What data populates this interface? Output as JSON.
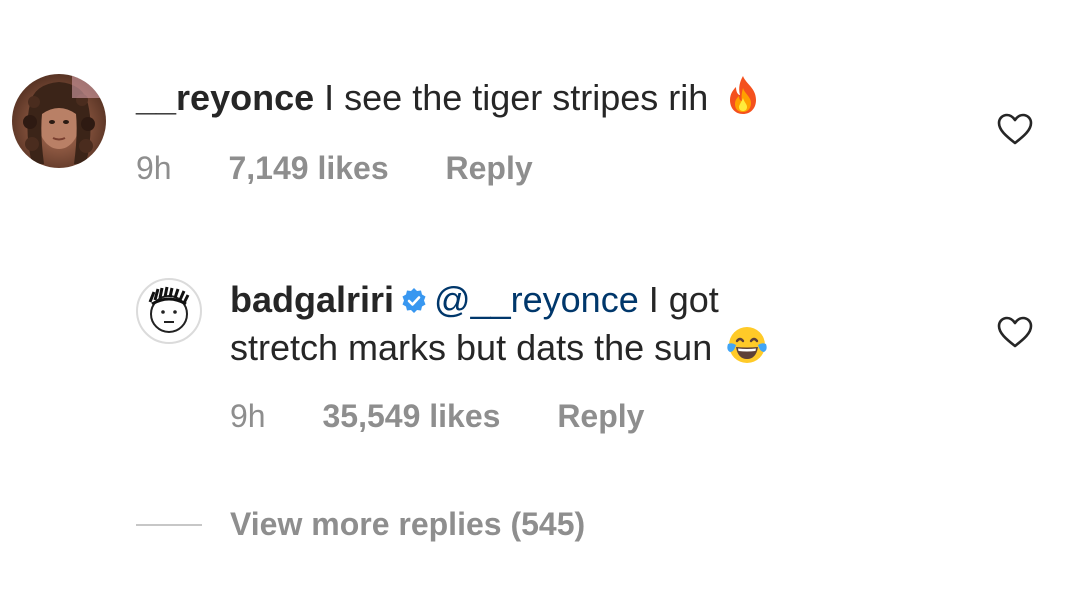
{
  "comment": {
    "username": "__reyonce",
    "text": "I see the tiger stripes rih",
    "emoji": "fire-emoji",
    "time": "9h",
    "likes": "7,149 likes",
    "reply_label": "Reply"
  },
  "reply": {
    "username": "badgalriri",
    "verified": true,
    "mention": "@__reyonce",
    "text_line1": "I got",
    "text_line2": "stretch marks but dats the sun",
    "emoji": "tears-of-joy-emoji",
    "time": "9h",
    "likes": "35,549 likes",
    "reply_label": "Reply"
  },
  "view_more": {
    "label": "View more replies (545)"
  },
  "colors": {
    "text": "#262626",
    "meta": "#8e8e8e",
    "mention": "#00376b",
    "verified": "#3897f0"
  }
}
